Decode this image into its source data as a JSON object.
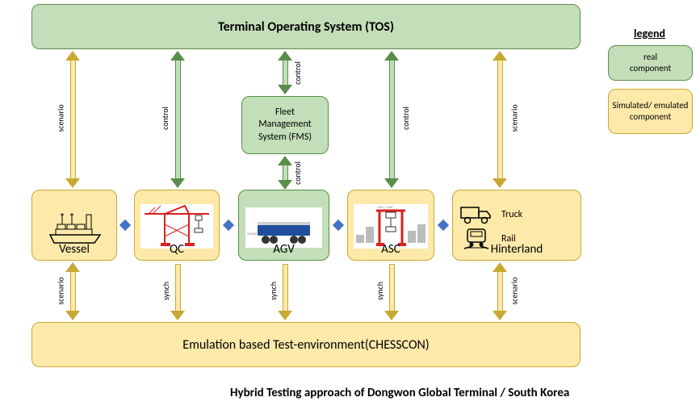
{
  "tos": {
    "label": "Terminal Operating System (TOS)"
  },
  "fms": {
    "label": "Fleet\nManagement\nSystem (FMS)"
  },
  "emulation": {
    "label": "Emulation based Test-environment(CHESSCON)"
  },
  "caption": "Hybrid Testing approach of Dongwon Global Terminal / South Korea",
  "legend": {
    "title": "legend",
    "real": "real\ncomponent",
    "sim": "Simulated/ emulated component"
  },
  "components": {
    "vessel": "Vessel",
    "qc": "QC",
    "agv": "AGV",
    "asc": "ASC",
    "hinterland": "Hinterland",
    "truck": "Truck",
    "rail": "Rail"
  },
  "arrows": {
    "scenario": "scenario",
    "control": "control",
    "synch": "synch"
  }
}
